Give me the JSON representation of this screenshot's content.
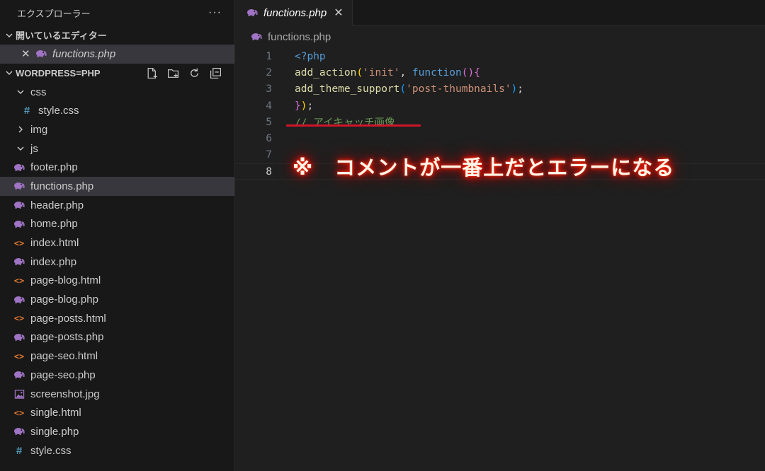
{
  "sidebar": {
    "title": "エクスプローラー",
    "more_icon": "more-icon",
    "open_editors": {
      "label": "開いているエディター",
      "items": [
        {
          "name": "functions.php",
          "icon": "php-icon"
        }
      ]
    },
    "workspace": {
      "label": "WORDPRESS=PHP",
      "actions": [
        "new-file-icon",
        "new-folder-icon",
        "refresh-icon",
        "collapse-all-icon"
      ],
      "tree": [
        {
          "name": "css",
          "type": "folder",
          "expanded": true
        },
        {
          "name": "style.css",
          "type": "css",
          "indent": 1
        },
        {
          "name": "img",
          "type": "folder",
          "expanded": false
        },
        {
          "name": "js",
          "type": "folder",
          "expanded": true
        },
        {
          "name": "footer.php",
          "type": "php"
        },
        {
          "name": "functions.php",
          "type": "php",
          "selected": true
        },
        {
          "name": "header.php",
          "type": "php"
        },
        {
          "name": "home.php",
          "type": "php"
        },
        {
          "name": "index.html",
          "type": "html"
        },
        {
          "name": "index.php",
          "type": "php"
        },
        {
          "name": "page-blog.html",
          "type": "html"
        },
        {
          "name": "page-blog.php",
          "type": "php"
        },
        {
          "name": "page-posts.html",
          "type": "html"
        },
        {
          "name": "page-posts.php",
          "type": "php"
        },
        {
          "name": "page-seo.html",
          "type": "html"
        },
        {
          "name": "page-seo.php",
          "type": "php"
        },
        {
          "name": "screenshot.jpg",
          "type": "image"
        },
        {
          "name": "single.html",
          "type": "html"
        },
        {
          "name": "single.php",
          "type": "php"
        },
        {
          "name": "style.css",
          "type": "css"
        }
      ]
    }
  },
  "editor": {
    "tab": {
      "label": "functions.php",
      "icon": "php-icon",
      "close_icon": "close-icon"
    },
    "breadcrumb": "functions.php",
    "active_line": 8,
    "line_numbers": [
      "1",
      "2",
      "3",
      "4",
      "5",
      "6",
      "7",
      "8"
    ],
    "code": {
      "l1": "<?php",
      "l2_fn": "add_action",
      "l2_str": "'init'",
      "l2_kw": "function",
      "l3_fn": "add_theme_support",
      "l3_str": "'post-thumbnails'",
      "l5_comment": "// アイキャッチ画像"
    }
  },
  "annotation": {
    "text": "※　コメントが一番上だとエラーになる",
    "glow_color": "#ff1a00",
    "underline_color": "#d0152a"
  }
}
